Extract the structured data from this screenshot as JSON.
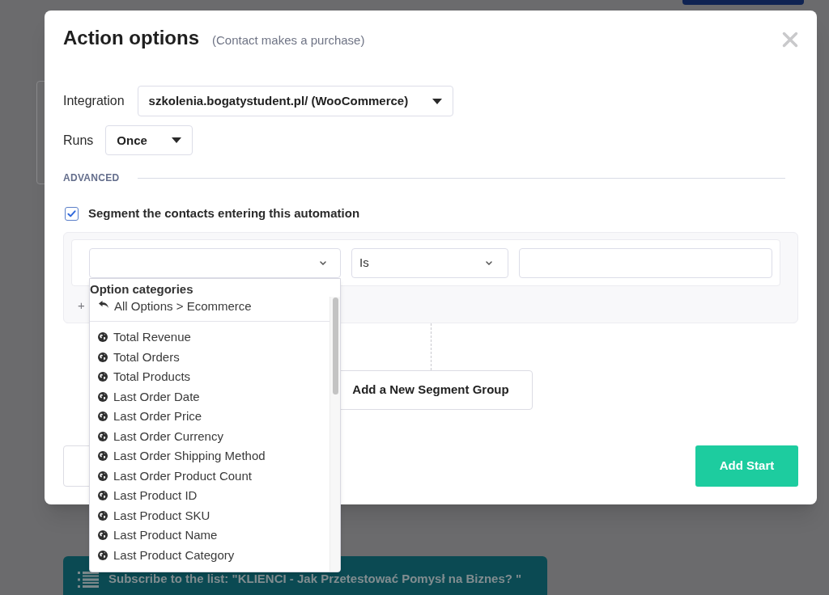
{
  "dialog": {
    "title": "Action options",
    "subtitle": "(Contact makes a purchase)",
    "fields": [
      {
        "label": "Integration",
        "value": "szkolenia.bogatystudent.pl/ (WooCommerce)"
      },
      {
        "label": "Runs",
        "value": "Once"
      }
    ],
    "section": "ADVANCED",
    "segment": {
      "label": "Segment the contacts entering this automation",
      "checked": true
    },
    "condition": {
      "operator": "Is",
      "add": "+"
    },
    "add_group_button": "Add a New Segment Group",
    "primary_button": "Add Start"
  },
  "dropdown": {
    "heading": "Option categories",
    "back": "All Options > Ecommerce",
    "options": [
      "Total Revenue",
      "Total Orders",
      "Total Products",
      "Last Order Date",
      "Last Order Price",
      "Last Order Currency",
      "Last Order Shipping Method",
      "Last Order Product Count",
      "Last Product ID",
      "Last Product SKU",
      "Last Product Name",
      "Last Product Category"
    ]
  },
  "page": {
    "list_bar": "Subscribe to the list: \"KLIENCI - Jak Przetestować Pomysł na Biznes? \""
  }
}
